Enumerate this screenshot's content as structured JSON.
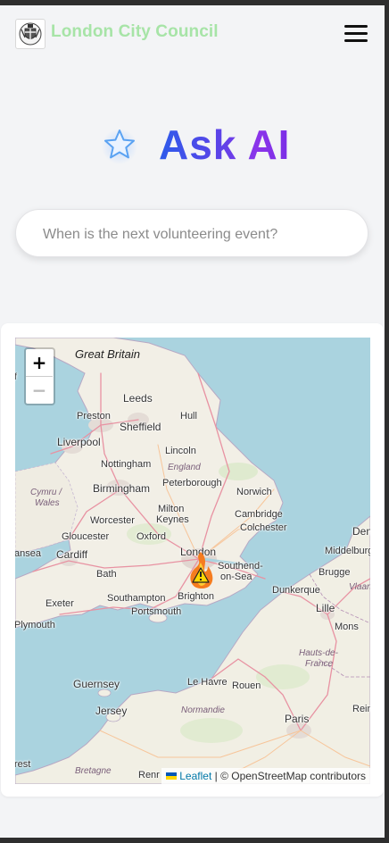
{
  "header": {
    "title": "London City Council",
    "logo_icon": "council-crest-icon",
    "menu_icon": "hamburger-menu-icon",
    "title_color": "#a7e4a7"
  },
  "hero": {
    "icon": "star-icon",
    "title": "Ask AI",
    "gradient_colors": [
      "#2d5bea",
      "#8b34ea"
    ]
  },
  "search": {
    "placeholder": "When is the next volunteering event?",
    "value": ""
  },
  "map": {
    "zoom_in": "+",
    "zoom_out": "−",
    "attribution_link": "Leaflet",
    "attribution_text": "| © OpenStreetMap contributors",
    "marker_icon": "fire-warning-marker-icon",
    "labels": {
      "great_britain": "Great Britain",
      "leeds": "Leeds",
      "preston": "Preston",
      "hull": "Hull",
      "sheffield": "Sheffield",
      "liverpool": "Liverpool",
      "lincoln": "Lincoln",
      "nottingham": "Nottingham",
      "england": "England",
      "birmingham": "Birmingham",
      "peterborough": "Peterborough",
      "norwich": "Norwich",
      "cymru": "Cymru /",
      "wales": "Wales",
      "worcester": "Worcester",
      "milton_keynes_1": "Milton",
      "milton_keynes_2": "Keynes",
      "cambridge": "Cambridge",
      "gloucester": "Gloucester",
      "oxford": "Oxford",
      "colchester": "Colchester",
      "swansea": "ansea",
      "cardiff": "Cardiff",
      "london": "London",
      "southend_1": "Southend-",
      "southend_2": "on-Sea",
      "bath": "Bath",
      "brighton": "Brighton",
      "dunkerque": "Dunkerque",
      "southampton": "Southampton",
      "exeter": "Exeter",
      "portsmouth": "Portsmouth",
      "lille": "Lille",
      "plymouth": "Plymouth",
      "mons": "Mons",
      "hauts_de_france_1": "Hauts-de-",
      "hauts_de_france_2": "France",
      "guernsey": "Guernsey",
      "le_havre": "Le Havre",
      "rouen": "Rouen",
      "jersey": "Jersey",
      "normandie": "Normandie",
      "paris": "Paris",
      "brest": "rest",
      "bretagne": "Bretagne",
      "rennes": "Renr",
      "middelburg": "Middelburg",
      "brugge": "Brugge",
      "vlaanderen": "Vlaan",
      "den": "Den",
      "reims": "Rein",
      "cork": "f"
    }
  }
}
